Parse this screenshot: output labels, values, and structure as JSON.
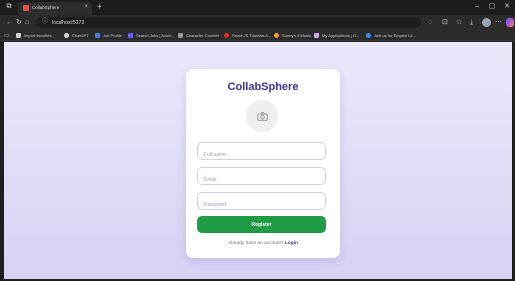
{
  "browser": {
    "tab_title": "CollabSphere",
    "url": "localhost:5173",
    "new_tab_label": "+",
    "bookmarks": [
      {
        "label": "Import favorites",
        "icon": "folder-icon",
        "color": "#cfcfcf"
      },
      {
        "label": "ChatGPT",
        "icon": "chatgpt-icon",
        "color": "#d9d9d9"
      },
      {
        "label": "Job Profile",
        "icon": "job-icon",
        "color": "#3a82f7"
      },
      {
        "label": "Search Jobs | Acom...",
        "icon": "search-jobs-icon",
        "color": "#6a5cff"
      },
      {
        "label": "Character Counter",
        "icon": "counter-icon",
        "color": "#9a9a9a"
      },
      {
        "label": "React JS Tutorials A...",
        "icon": "youtube-icon",
        "color": "#e02c2c"
      },
      {
        "label": "Sunny's 9 Music",
        "icon": "music-icon",
        "color": "#f0a030"
      },
      {
        "label": "My Applications | G...",
        "icon": "apps-icon",
        "color": "#d6a4f2"
      },
      {
        "label": "Join us for Empirix La...",
        "icon": "empirix-icon",
        "color": "#3b8ef0"
      }
    ]
  },
  "card": {
    "brand": "CollabSphere",
    "avatar_icon": "camera-icon",
    "fields": {
      "full_name_placeholder": "Full name",
      "email_placeholder": "Email",
      "password_placeholder": "Password"
    },
    "register_label": "Register",
    "login_prompt": "Already have an account?",
    "login_link": "Login"
  },
  "colors": {
    "brand": "#3c3494",
    "register_button": "#1f9a45",
    "page_bg": "#e4e2f9"
  }
}
